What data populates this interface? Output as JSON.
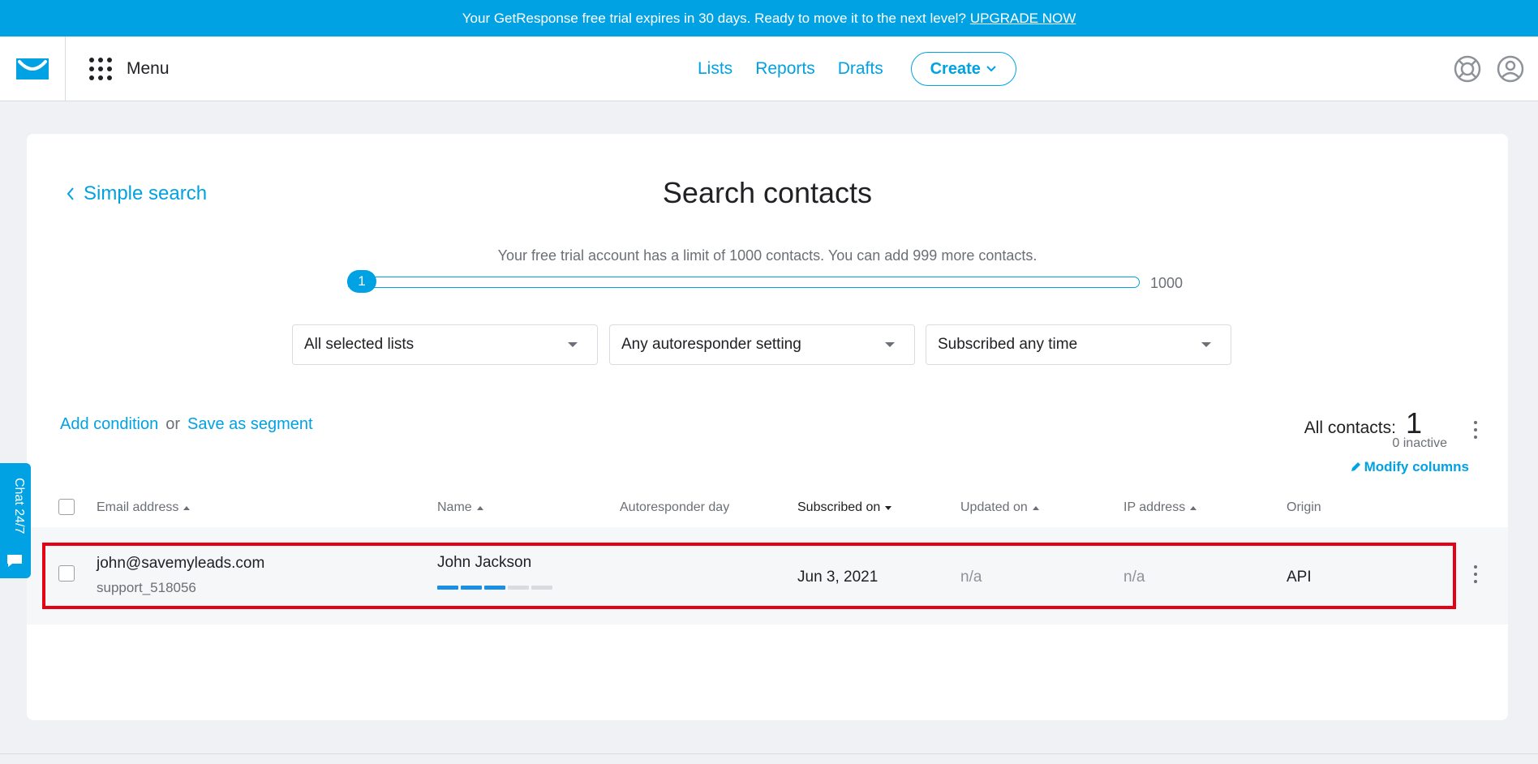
{
  "banner": {
    "text": "Your GetResponse free trial expires in 30 days. Ready to move it to the next level?",
    "upgrade_link": "UPGRADE NOW"
  },
  "header": {
    "menu_label": "Menu",
    "nav": [
      "Lists",
      "Reports",
      "Drafts"
    ],
    "create_label": "Create"
  },
  "search": {
    "back_link": "Simple search",
    "title": "Search contacts",
    "limit_text": "Your free trial account has a limit of 1000 contacts. You can add 999 more contacts.",
    "slider": {
      "value": "1",
      "max": "1000",
      "fill_fraction": 0.001
    },
    "filters": [
      {
        "selected": "All selected lists"
      },
      {
        "selected": "Any autoresponder setting"
      },
      {
        "selected": "Subscribed any time"
      }
    ],
    "add_condition": "Add condition",
    "or": "or",
    "save_segment": "Save as segment"
  },
  "summary": {
    "all_contacts_label": "All contacts:",
    "count": "1",
    "inactive": "0 inactive",
    "modify_columns": "Modify columns"
  },
  "table": {
    "columns": [
      "Email address",
      "Name",
      "Autoresponder day",
      "Subscribed on",
      "Updated on",
      "IP address",
      "Origin"
    ],
    "rows": [
      {
        "email": "john@savemyleads.com",
        "list": "support_518056",
        "name": "John Jackson",
        "engagement_level": 3,
        "engagement_max": 5,
        "autoresponder_day": "",
        "subscribed_on": "Jun 3, 2021",
        "updated_on": "n/a",
        "ip_address": "n/a",
        "origin": "API"
      }
    ]
  },
  "chat": {
    "label": "Chat 24/7"
  },
  "colors": {
    "accent": "#00a2e3",
    "highlight": "#e60013",
    "engagement_on": "#1a8fe3",
    "engagement_off": "#d8dce1"
  }
}
